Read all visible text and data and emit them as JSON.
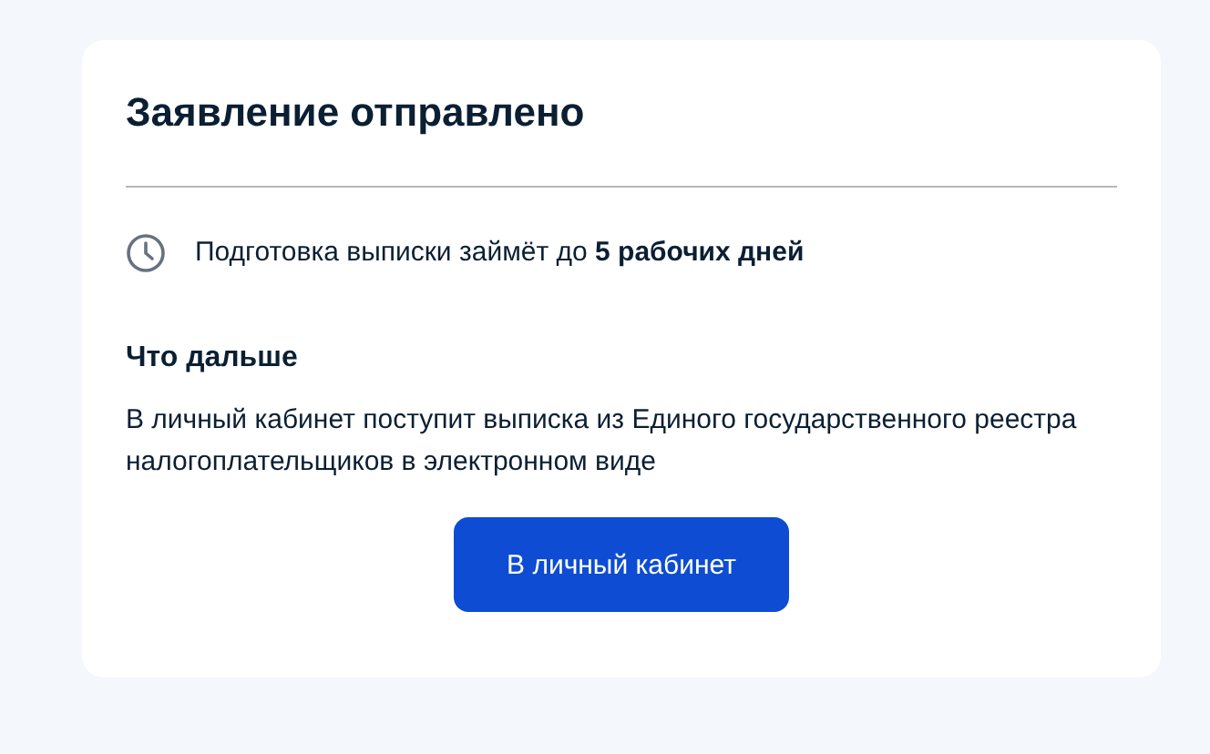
{
  "card": {
    "title": "Заявление отправлено",
    "notice": "Подготовка выписки займёт до **5 рабочих дней**",
    "next_heading": "Что дальше",
    "next_text": "В личный кабинет поступит выписка из Единого государственного реестра налогоплательщиков в электронном виде",
    "button": "В личный кабинет"
  }
}
